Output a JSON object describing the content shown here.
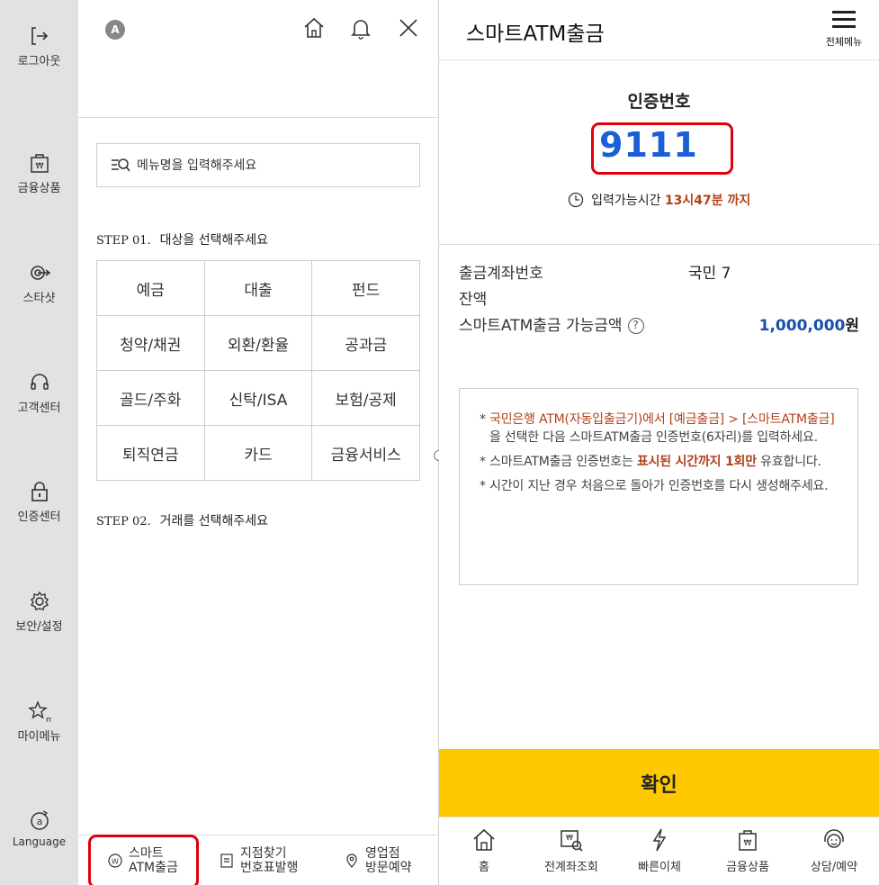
{
  "rail": {
    "items": [
      {
        "label": "로그아웃",
        "icon": "logout-icon"
      },
      {
        "label": "금융상품",
        "icon": "financial-product-icon"
      },
      {
        "label": "스타샷",
        "icon": "starshot-icon"
      },
      {
        "label": "고객센터",
        "icon": "headset-icon"
      },
      {
        "label": "인증센터",
        "icon": "lock-icon"
      },
      {
        "label": "보안/설정",
        "icon": "gear-icon"
      },
      {
        "label": "마이메뉴",
        "icon": "star-icon"
      },
      {
        "label": "Language",
        "icon": "language-icon"
      }
    ]
  },
  "menu": {
    "avatar_letter": "A",
    "search_placeholder": "메뉴명을 입력해주세요",
    "step1": {
      "num": "STEP 01.",
      "text": "대상을 선택해주세요"
    },
    "step2": {
      "num": "STEP 02.",
      "text": "거래를 선택해주세요"
    },
    "categories": [
      [
        "예금",
        "대출",
        "펀드"
      ],
      [
        "청약/채권",
        "외환/환율",
        "공과금"
      ],
      [
        "골드/주화",
        "신탁/ISA",
        "보험/공제"
      ],
      [
        "퇴직연금",
        "카드",
        "금융서비스"
      ]
    ],
    "bottom": [
      {
        "line1": "스마트",
        "line2": "ATM출금",
        "icon": "atm-won-icon"
      },
      {
        "line1": "지점찾기",
        "line2": "번호표발행",
        "icon": "ticket-icon"
      },
      {
        "line1": "영업점",
        "line2": "방문예약",
        "icon": "location-pin-icon"
      }
    ]
  },
  "screen": {
    "title": "스마트ATM출금",
    "menu_label": "전체메뉴",
    "auth_label": "인증번호",
    "auth_code": "9111",
    "time_prefix": "입력가능시간",
    "time_value": "13시47분 까지",
    "account_label": "출금계좌번호",
    "account_value": "국민 7",
    "balance_label": "잔액",
    "available_label": "스마트ATM출금 가능금액",
    "available_amount": "1,000,000",
    "available_unit": "원",
    "notice": {
      "n1_a": "국민은행 ATM(자동입출금기)에서 [예금출금] > [스마트ATM출금]",
      "n1_b": "을 선택한 다음 스마트ATM출금 인증번호(6자리)를 입력하세요.",
      "n2_a": "스마트ATM출금 인증번호는 ",
      "n2_b": "표시된 시간까지 1회만",
      "n2_c": " 유효합니다.",
      "n3": "시간이 지난 경우 처음으로 돌아가 인증번호를 다시 생성해주세요."
    },
    "confirm_label": "확인",
    "tabs": [
      {
        "label": "홈",
        "icon": "home-icon"
      },
      {
        "label": "전계좌조회",
        "icon": "account-search-icon"
      },
      {
        "label": "빠른이체",
        "icon": "lightning-icon"
      },
      {
        "label": "금융상품",
        "icon": "financial-product-icon"
      },
      {
        "label": "상담/예약",
        "icon": "headset-icon"
      }
    ]
  },
  "colors": {
    "accent_yellow": "#ffc900",
    "highlight_red": "#e0000b",
    "code_blue": "#1c5ed6",
    "emphasis_orange": "#b3401a"
  }
}
